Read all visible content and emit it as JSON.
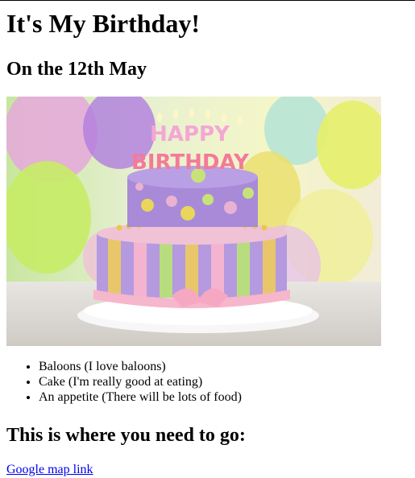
{
  "heading": "It's My Birthday!",
  "date": "On the 12th May",
  "image": {
    "description_icon": "birthday-cake-image",
    "candle_text_line1": "HAPPY",
    "candle_text_line2": "BIRTHDAY"
  },
  "list": {
    "items": [
      "Baloons (I love baloons)",
      "Cake (I'm really good at eating)",
      "An appetite (There will be lots of food)"
    ]
  },
  "directions_heading": "This is where you need to go:",
  "map_link": {
    "label": "Google map link"
  },
  "colors": {
    "link": "#0000ee",
    "text": "#000000"
  }
}
